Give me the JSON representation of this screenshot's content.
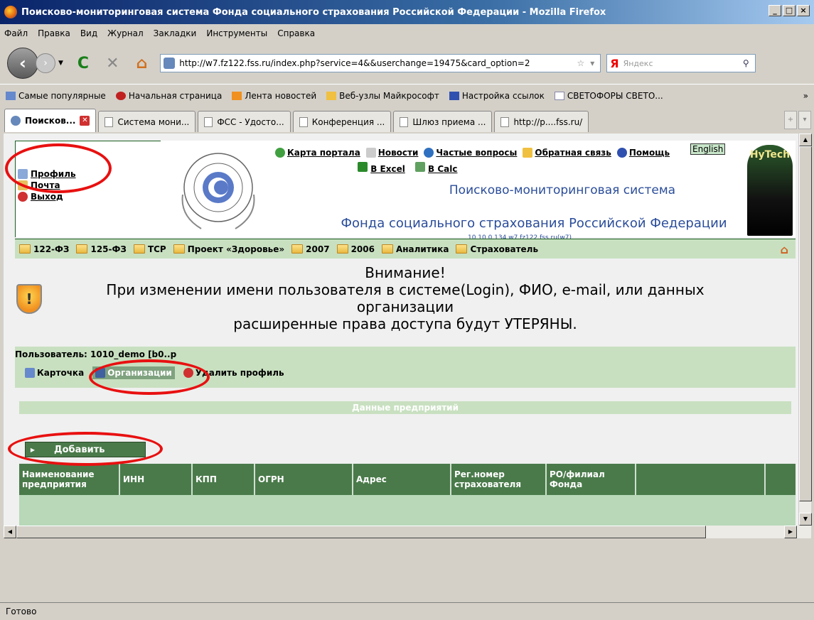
{
  "window": {
    "title": "Поисково-мониторинговая система Фонда социального страхования Российской Федерации - Mozilla Firefox",
    "btn_min": "_",
    "btn_max": "□",
    "btn_close": "×"
  },
  "menu": [
    "Файл",
    "Правка",
    "Вид",
    "Журнал",
    "Закладки",
    "Инструменты",
    "Справка"
  ],
  "nav": {
    "url": "http://w7.fz122.fss.ru/index.php?service=4&&userchange=19475&card_option=2",
    "search_placeholder": "Яндекс",
    "search_logo": "Я"
  },
  "bookmarks": [
    "Самые популярные",
    "Начальная страница",
    "Лента новостей",
    "Веб-узлы Майкрософт",
    "Настройка ссылок",
    "СВЕТОФОРЫ СВЕТО..."
  ],
  "bookmarks_more": "»",
  "tabs": [
    "Поисков...",
    "Система мони...",
    "ФСС - Удосто...",
    "Конференция ...",
    "Шлюз приема ...",
    "http://p....fss.ru/"
  ],
  "header": {
    "profile": "Профиль",
    "mail": "Почта",
    "exit": "Выход",
    "links": [
      "Карта портала",
      "Новости",
      "Частые вопросы",
      "Обратная связь",
      "Помощь"
    ],
    "english": "English",
    "excel": "В Excel",
    "calc": "В Calc",
    "system_line1": "Поисково-мониторинговая система",
    "system_line2": "Фонда социального страхования Российской Федерации",
    "ip": "10.10.0.134  w7.fz122.fss.ru(w7)",
    "logo_text": "HyTech"
  },
  "green_nav": [
    "122-ФЗ",
    "125-ФЗ",
    "ТСР",
    "Проект «Здоровье»",
    "2007",
    "2006",
    "Аналитика",
    "Страхователь"
  ],
  "warning": {
    "line1": "Внимание!",
    "line2": "При изменении имени пользователя в системе(Login), ФИО, e-mail, или данных",
    "line3": "организации",
    "line4": "расширенные права доступа будут УТЕРЯНЫ."
  },
  "user": {
    "label": "Пользователь: 1010_demo [b0..p",
    "card": "Карточка",
    "orgs": "Организации",
    "delete": "Удалить профиль"
  },
  "section_title": "Данные предприятий",
  "add_button": "Добавить",
  "table": {
    "columns": [
      "Наименование предприятия",
      "ИНН",
      "КПП",
      "ОГРН",
      "Адрес",
      "Рег.номер страхователя",
      "РО/филиал Фонда",
      ""
    ]
  },
  "status": "Готово",
  "colors": {
    "accent_green": "#4a7a4a",
    "light_green": "#c8e0c0",
    "annotation_red": "#e81010",
    "system_blue": "#2a4d9a"
  }
}
